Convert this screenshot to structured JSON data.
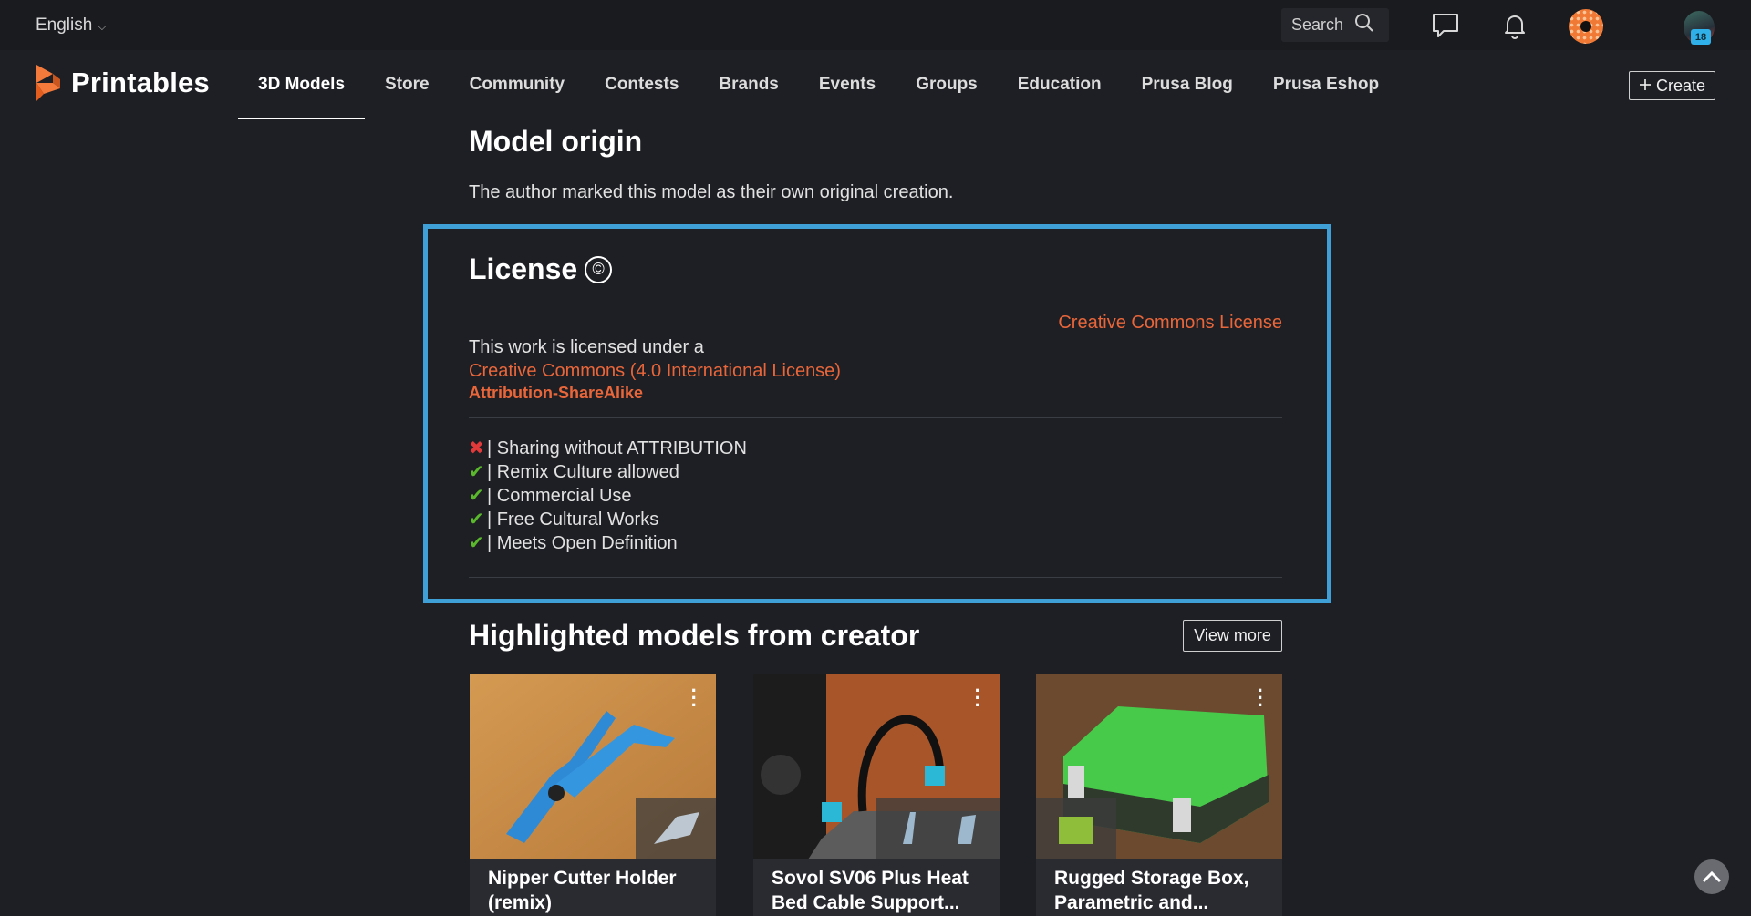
{
  "topbar": {
    "language": "English",
    "search_label": "Search",
    "notifications_badge": "18"
  },
  "nav": {
    "brand": "Printables",
    "items": [
      {
        "label": "3D Models",
        "active": true
      },
      {
        "label": "Store"
      },
      {
        "label": "Community"
      },
      {
        "label": "Contests"
      },
      {
        "label": "Brands"
      },
      {
        "label": "Events"
      },
      {
        "label": "Groups"
      },
      {
        "label": "Education"
      },
      {
        "label": "Prusa Blog"
      },
      {
        "label": "Prusa Eshop"
      }
    ],
    "create_label": "Create"
  },
  "origin": {
    "title": "Model origin",
    "text": "The author marked this model as their own original creation."
  },
  "license": {
    "title": "License",
    "symbol": "©",
    "right_link": "Creative Commons License",
    "intro": "This work is licensed under a",
    "link": "Creative Commons (4.0 International License)",
    "type": "Attribution-ShareAlike",
    "permissions": [
      {
        "mark": "✖",
        "allowed": false,
        "text": " | Sharing without ATTRIBUTION"
      },
      {
        "mark": "✔",
        "allowed": true,
        "text": " | Remix Culture allowed"
      },
      {
        "mark": "✔",
        "allowed": true,
        "text": " | Commercial Use"
      },
      {
        "mark": "✔",
        "allowed": true,
        "text": " | Free Cultural Works"
      },
      {
        "mark": "✔",
        "allowed": true,
        "text": " | Meets Open Definition"
      }
    ]
  },
  "highlighted": {
    "title": "Highlighted models from creator",
    "view_more": "View more",
    "cards": [
      {
        "title_line1": "Nipper Cutter Holder",
        "title_line2": "(remix)"
      },
      {
        "title_line1": "Sovol SV06 Plus Heat",
        "title_line2": "Bed Cable Support..."
      },
      {
        "title_line1": "Rugged Storage Box,",
        "title_line2": "Parametric and..."
      }
    ]
  },
  "colors": {
    "accent_orange": "#e9663a",
    "license_border": "#3ea0d6",
    "background": "#1e1f24"
  }
}
